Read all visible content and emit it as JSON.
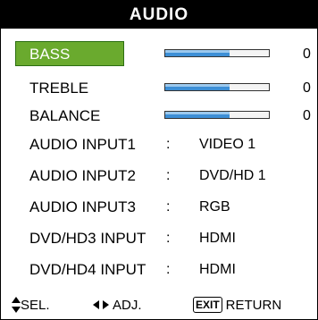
{
  "header": {
    "title": "AUDIO"
  },
  "colors": {
    "header_bg": "#000000",
    "selected_bg": "#6aaa2e",
    "slider_fill": "#3d8fd6"
  },
  "sliders": [
    {
      "label": "BASS",
      "value": "0",
      "level": 0.62,
      "selected": true
    },
    {
      "label": "TREBLE",
      "value": "0",
      "level": 0.62,
      "selected": false
    },
    {
      "label": "BALANCE",
      "value": "0",
      "level": 0.62,
      "selected": false
    }
  ],
  "settings": [
    {
      "label": "AUDIO INPUT1",
      "sep": ":",
      "value": "VIDEO 1"
    },
    {
      "label": "AUDIO INPUT2",
      "sep": ":",
      "value": "DVD/HD 1"
    },
    {
      "label": "AUDIO INPUT3",
      "sep": ":",
      "value": "RGB"
    },
    {
      "label": "DVD/HD3 INPUT",
      "sep": ":",
      "value": "HDMI"
    },
    {
      "label": "DVD/HD4 INPUT",
      "sep": ":",
      "value": "HDMI"
    }
  ],
  "footer": {
    "sel_label": "SEL.",
    "adj_label": "ADJ.",
    "exit_icon_text": "EXIT",
    "return_label": "RETURN",
    "icons": {
      "sel": "up-down-arrows-icon",
      "adj": "left-right-arrows-icon",
      "exit": "exit-button-icon"
    }
  }
}
